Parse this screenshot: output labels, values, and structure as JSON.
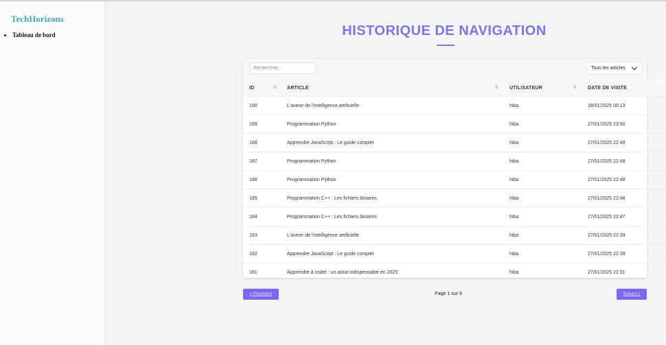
{
  "sidebar": {
    "brand": "TechHorizons",
    "items": [
      {
        "label": "Tableau de bord"
      }
    ]
  },
  "page": {
    "title": "HISTORIQUE DE NAVIGATION"
  },
  "toolbar": {
    "search_placeholder": "Rechercher...",
    "filter_selected": "Tous les articles"
  },
  "table": {
    "columns": [
      "ID",
      "ARTICLE",
      "UTILISATEUR",
      "DATE DE VISITE"
    ],
    "rows": [
      {
        "id": "190",
        "article": "L'avenir de l'intelligence artificielle",
        "user": "hiba",
        "date": "28/01/2025 00:13"
      },
      {
        "id": "189",
        "article": "Programmation Python",
        "user": "hiba",
        "date": "27/01/2025 23:50"
      },
      {
        "id": "188",
        "article": "Apprendre JavaScript : Le guide complet",
        "user": "hiba",
        "date": "27/01/2025 22:48"
      },
      {
        "id": "187",
        "article": "Programmation Python",
        "user": "hiba",
        "date": "27/01/2025 22:48"
      },
      {
        "id": "186",
        "article": "Programmation Python",
        "user": "hiba",
        "date": "27/01/2025 22:48"
      },
      {
        "id": "185",
        "article": "Programmation C++ : Les fichiers binaires",
        "user": "hiba",
        "date": "27/01/2025 22:48"
      },
      {
        "id": "184",
        "article": "Programmation C++ : Les fichiers binaires",
        "user": "hiba",
        "date": "27/01/2025 22:47"
      },
      {
        "id": "183",
        "article": "L'avenir de l'intelligence artificielle",
        "user": "hiba",
        "date": "27/01/2025 22:39"
      },
      {
        "id": "182",
        "article": "Apprendre JavaScript : Le guide complet",
        "user": "hiba",
        "date": "27/01/2025 22:39"
      },
      {
        "id": "181",
        "article": "Apprendre à coder : un atout indispensable en 2025",
        "user": "hiba",
        "date": "27/01/2025 22:31"
      }
    ]
  },
  "pagination": {
    "prev_label": "« Précédent",
    "next_label": "Suivant »",
    "page_info": "Page 1 sur 9"
  },
  "colors": {
    "accent": "#7c76e0",
    "button": "#7b67f0",
    "brand": "#4aa3c0"
  }
}
